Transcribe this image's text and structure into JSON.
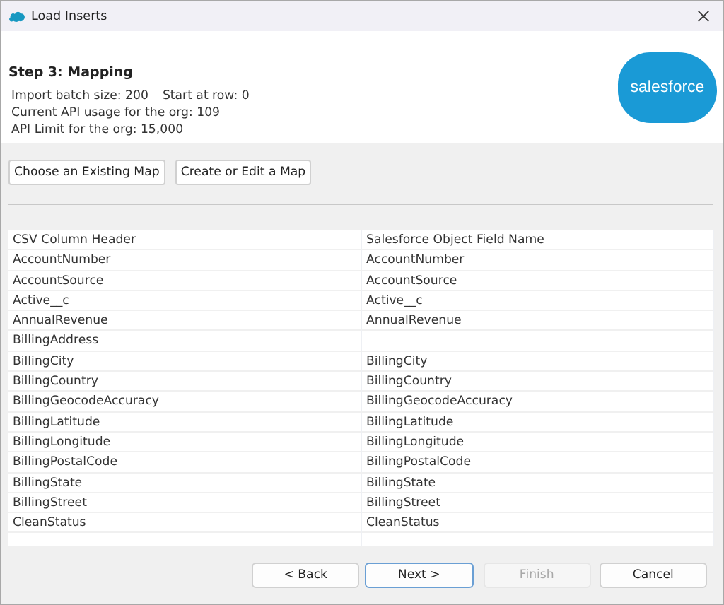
{
  "window": {
    "title": "Load Inserts"
  },
  "header": {
    "title": "Step 3: Mapping",
    "info": [
      "Import batch size: 200",
      "Start at row: 0"
    ],
    "lines": [
      "Current API usage for the org: 109",
      "API Limit for the org: 15,000"
    ],
    "logo": "salesforce"
  },
  "map_buttons": [
    "Choose an Existing Map",
    "Create or Edit a Map"
  ],
  "table": {
    "columns": [
      "CSV Column Header",
      "Salesforce Object Field Name"
    ],
    "rows": [
      [
        "AccountNumber",
        "AccountNumber"
      ],
      [
        "AccountSource",
        "AccountSource"
      ],
      [
        "Active__c",
        "Active__c"
      ],
      [
        "AnnualRevenue",
        "AnnualRevenue"
      ],
      [
        "BillingAddress",
        ""
      ],
      [
        "BillingCity",
        "BillingCity"
      ],
      [
        "BillingCountry",
        "BillingCountry"
      ],
      [
        "BillingGeocodeAccuracy",
        "BillingGeocodeAccuracy"
      ],
      [
        "BillingLatitude",
        "BillingLatitude"
      ],
      [
        "BillingLongitude",
        "BillingLongitude"
      ],
      [
        "BillingPostalCode",
        "BillingPostalCode"
      ],
      [
        "BillingState",
        "BillingState"
      ],
      [
        "BillingStreet",
        "BillingStreet"
      ],
      [
        "CleanStatus",
        "CleanStatus"
      ]
    ]
  },
  "buttons": [
    {
      "label": "< Back",
      "disabled": false,
      "selected": false
    },
    {
      "label": "Next >",
      "disabled": false,
      "selected": true
    },
    {
      "label": "Finish",
      "disabled": true,
      "selected": false
    },
    {
      "label": "Cancel",
      "disabled": false,
      "selected": false
    }
  ]
}
